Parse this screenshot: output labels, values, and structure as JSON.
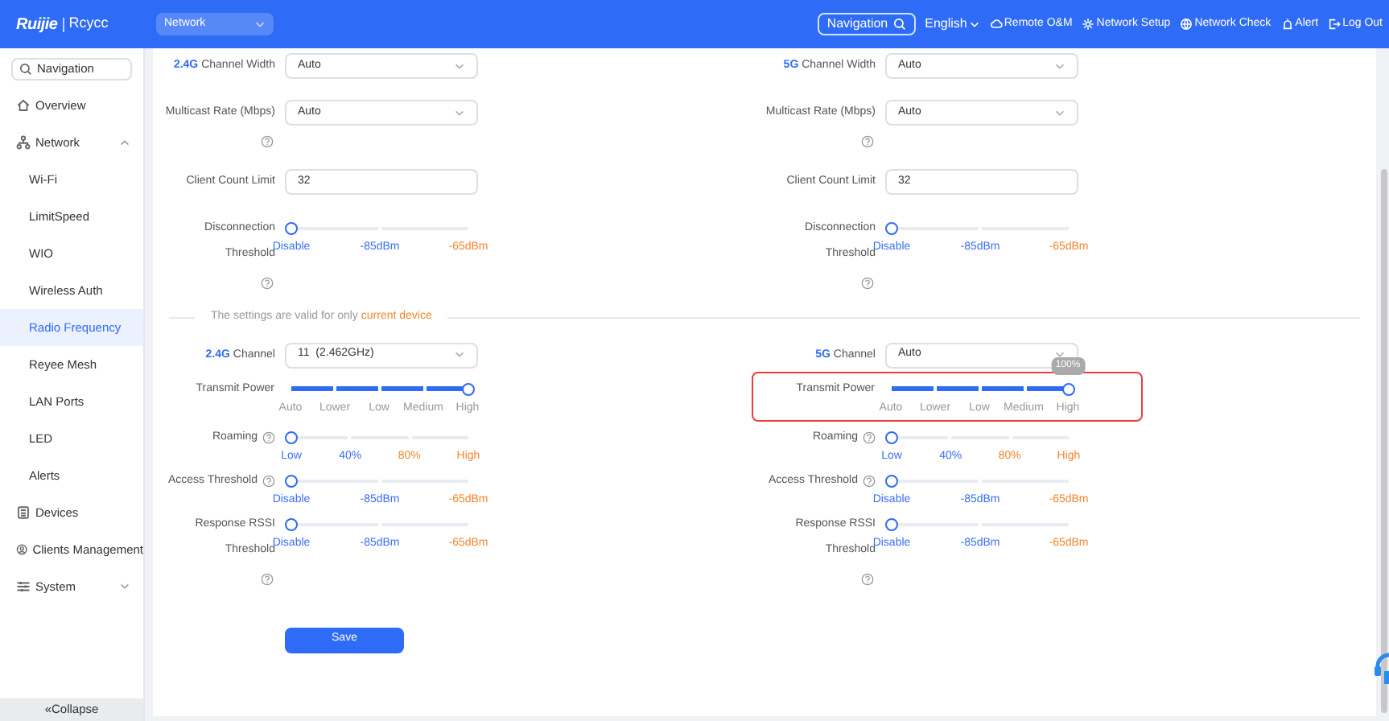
{
  "header": {
    "logo": {
      "brand": "Ruijie",
      "product": "Rcycc"
    },
    "project_select": "Network",
    "nav_search": "Navigation",
    "language": "English",
    "actions": [
      {
        "kind": "cloud",
        "label": "Remote O&M"
      },
      {
        "kind": "setup",
        "label": "Network Setup"
      },
      {
        "kind": "check",
        "label": "Network Check"
      },
      {
        "kind": "alert",
        "label": "Alert"
      },
      {
        "kind": "logout",
        "label": "Log Out"
      }
    ]
  },
  "sidebar": {
    "search_placeholder": "Navigation",
    "items": [
      {
        "kind": "home",
        "label": "Overview",
        "selected": false
      },
      {
        "kind": "network",
        "label": "Network",
        "selected": false,
        "expanded": true,
        "children": [
          {
            "label": "Wi-Fi",
            "selected": false
          },
          {
            "label": "LimitSpeed",
            "selected": false
          },
          {
            "label": "WIO",
            "selected": false
          },
          {
            "label": "Wireless Auth",
            "selected": false
          },
          {
            "label": "Radio Frequency",
            "selected": true
          },
          {
            "label": "Reyee Mesh",
            "selected": false
          },
          {
            "label": "LAN Ports",
            "selected": false
          },
          {
            "label": "LED",
            "selected": false
          },
          {
            "label": "Alerts",
            "selected": false
          }
        ]
      },
      {
        "kind": "devices",
        "label": "Devices",
        "selected": false
      },
      {
        "kind": "clients",
        "label": "Clients Management",
        "selected": false
      },
      {
        "kind": "system",
        "label": "System",
        "selected": false,
        "expanded": false
      }
    ],
    "collapse": "«Collapse"
  },
  "general": {
    "columns": [
      {
        "fields": [
          {
            "kind": "select",
            "band": "2.4G",
            "label": "Channel Width",
            "value": "Auto"
          },
          {
            "kind": "select",
            "label": "Multicast Rate (Mbps)",
            "help_below": true,
            "value": "Auto"
          },
          {
            "kind": "input",
            "label": "Client Count Limit",
            "value": "32"
          },
          {
            "kind": "slider",
            "label": "Disconnection Threshold",
            "help_below": true,
            "level": 0,
            "ticks": [
              {
                "label": "Disable",
                "color": "#3b6ff5"
              },
              {
                "label": "-85dBm",
                "color": "#3b6ff5"
              },
              {
                "label": "-65dBm",
                "color": "#f5852f"
              }
            ]
          }
        ]
      },
      {
        "fields": [
          {
            "kind": "select",
            "band": "5G",
            "label": "Channel Width",
            "value": "Auto"
          },
          {
            "kind": "select",
            "label": "Multicast Rate (Mbps)",
            "help_below": true,
            "value": "Auto"
          },
          {
            "kind": "input",
            "label": "Client Count Limit",
            "value": "32"
          },
          {
            "kind": "slider",
            "label": "Disconnection Threshold",
            "help_below": true,
            "level": 0,
            "ticks": [
              {
                "label": "Disable",
                "color": "#3b6ff5"
              },
              {
                "label": "-85dBm",
                "color": "#3b6ff5"
              },
              {
                "label": "-65dBm",
                "color": "#f5852f"
              }
            ]
          }
        ]
      }
    ]
  },
  "device_note": {
    "text": "The settings are valid for only ",
    "highlight": "current device"
  },
  "device": {
    "columns": [
      {
        "fields": [
          {
            "kind": "select",
            "band": "2.4G",
            "label": "Channel",
            "value": "11  (2.462GHz)"
          },
          {
            "kind": "power",
            "label": "Transmit Power",
            "level": 1,
            "highlighted": false,
            "ticks": [
              {
                "label": "Auto",
                "color": "#999999"
              },
              {
                "label": "Lower",
                "color": "#999999"
              },
              {
                "label": "Low",
                "color": "#999999"
              },
              {
                "label": "Medium",
                "color": "#999999"
              },
              {
                "label": "High",
                "color": "#999999"
              }
            ]
          },
          {
            "kind": "slider",
            "label": "Roaming",
            "help_inline": true,
            "level": 0,
            "ticks": [
              {
                "label": "Low",
                "color": "#3b6ff5"
              },
              {
                "label": "40%",
                "color": "#3b6ff5"
              },
              {
                "label": "80%",
                "color": "#f5852f"
              },
              {
                "label": "High",
                "color": "#f5852f"
              }
            ]
          },
          {
            "kind": "slider",
            "label": "Access Threshold",
            "help_inline": true,
            "level": 0,
            "ticks": [
              {
                "label": "Disable",
                "color": "#3b6ff5"
              },
              {
                "label": "-85dBm",
                "color": "#3b6ff5"
              },
              {
                "label": "-65dBm",
                "color": "#f5852f"
              }
            ]
          },
          {
            "kind": "slider",
            "label": "Response RSSI Threshold",
            "help_below": true,
            "level": 0,
            "ticks": [
              {
                "label": "Disable",
                "color": "#3b6ff5"
              },
              {
                "label": "-85dBm",
                "color": "#3b6ff5"
              },
              {
                "label": "-65dBm",
                "color": "#f5852f"
              }
            ]
          }
        ]
      },
      {
        "fields": [
          {
            "kind": "select",
            "band": "5G",
            "label": "Channel",
            "value": "Auto"
          },
          {
            "kind": "power",
            "label": "Transmit Power",
            "level": 1,
            "highlighted": true,
            "tooltip": "100%",
            "ticks": [
              {
                "label": "Auto",
                "color": "#999999"
              },
              {
                "label": "Lower",
                "color": "#999999"
              },
              {
                "label": "Low",
                "color": "#999999"
              },
              {
                "label": "Medium",
                "color": "#999999"
              },
              {
                "label": "High",
                "color": "#999999"
              }
            ]
          },
          {
            "kind": "slider",
            "label": "Roaming",
            "help_inline": true,
            "level": 0,
            "ticks": [
              {
                "label": "Low",
                "color": "#3b6ff5"
              },
              {
                "label": "40%",
                "color": "#3b6ff5"
              },
              {
                "label": "80%",
                "color": "#f5852f"
              },
              {
                "label": "High",
                "color": "#f5852f"
              }
            ]
          },
          {
            "kind": "slider",
            "label": "Access Threshold",
            "help_inline": true,
            "level": 0,
            "ticks": [
              {
                "label": "Disable",
                "color": "#3b6ff5"
              },
              {
                "label": "-85dBm",
                "color": "#3b6ff5"
              },
              {
                "label": "-65dBm",
                "color": "#f5852f"
              }
            ]
          },
          {
            "kind": "slider",
            "label": "Response RSSI Threshold",
            "help_below": true,
            "level": 0,
            "ticks": [
              {
                "label": "Disable",
                "color": "#3b6ff5"
              },
              {
                "label": "-85dBm",
                "color": "#3b6ff5"
              },
              {
                "label": "-65dBm",
                "color": "#f5852f"
              }
            ]
          }
        ]
      }
    ]
  },
  "save_button": "Save"
}
